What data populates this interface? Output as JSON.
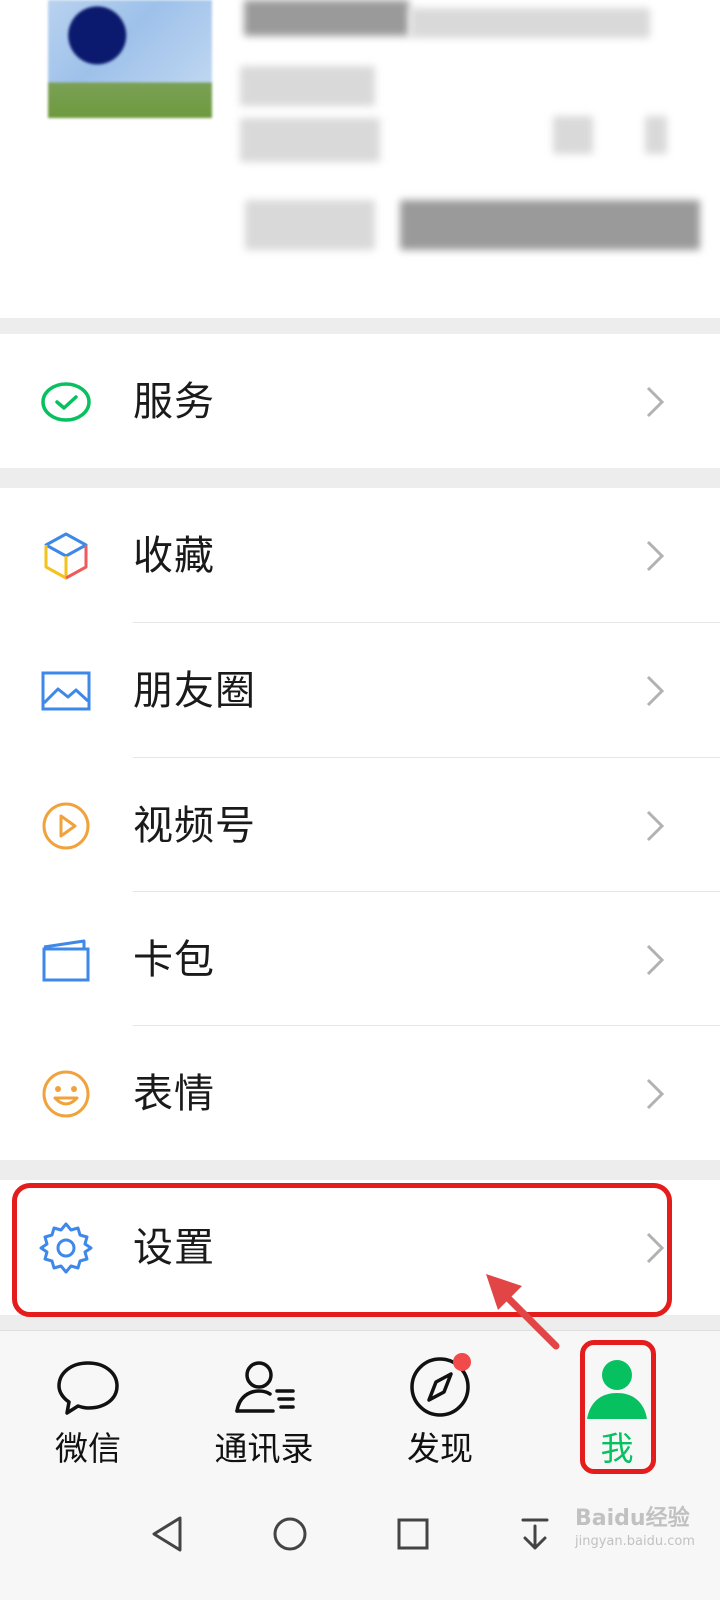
{
  "menu_groups": [
    {
      "items": [
        {
          "label": "服务",
          "icon": "wechat-pay-icon",
          "color": "#07c160"
        }
      ]
    },
    {
      "items": [
        {
          "label": "收藏",
          "icon": "cube-icon",
          "color": "#3d88e9"
        },
        {
          "label": "朋友圈",
          "icon": "photo-icon",
          "color": "#3d88e9"
        },
        {
          "label": "视频号",
          "icon": "play-circle-icon",
          "color": "#f0a33c"
        },
        {
          "label": "卡包",
          "icon": "card-icon",
          "color": "#3d88e9"
        },
        {
          "label": "表情",
          "icon": "smile-icon",
          "color": "#f0a33c"
        }
      ]
    },
    {
      "items": [
        {
          "label": "设置",
          "icon": "gear-icon",
          "color": "#3d88e9"
        }
      ]
    }
  ],
  "tabs": [
    {
      "label": "微信",
      "icon": "chat-bubble-icon",
      "active": false,
      "badge": false
    },
    {
      "label": "通讯录",
      "icon": "contacts-icon",
      "active": false,
      "badge": false
    },
    {
      "label": "发现",
      "icon": "compass-icon",
      "active": false,
      "badge": true
    },
    {
      "label": "我",
      "icon": "person-icon",
      "active": true,
      "badge": false
    }
  ],
  "colors": {
    "accent": "#07c160",
    "annotation": "#e41c1c",
    "badge": "#f04a4a"
  },
  "watermark": {
    "text": "Baidu经验",
    "sub": "jingyan.baidu.com"
  }
}
